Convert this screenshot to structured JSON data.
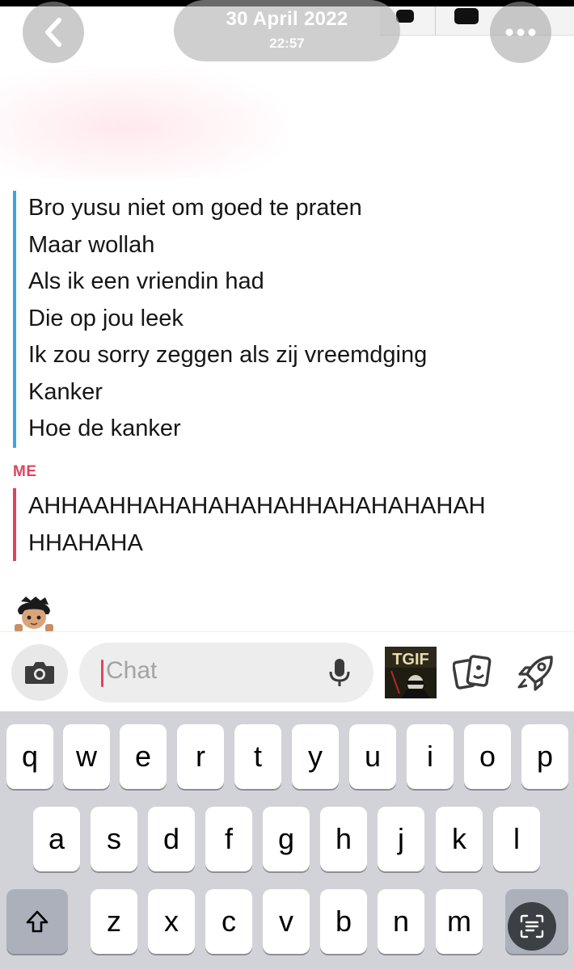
{
  "header": {
    "date": "30 April 2022",
    "time": "22:57"
  },
  "conversation": {
    "incoming_lines": [
      "Bro yusu niet om goed te praten",
      "Maar wollah",
      "Als ik een vriendin had",
      "Die op jou leek",
      "Ik zou sorry zeggen als zij vreemdging",
      "Kanker",
      "Hoe de kanker"
    ],
    "me_label": "ME",
    "outgoing_lines": [
      "AHHAAHHAHAHAHAHAHHAHAHAHAHAH",
      "HHAHAHA"
    ],
    "colors": {
      "incoming_bar": "#3aa7e0",
      "outgoing_bar": "#e0435c"
    }
  },
  "chat_bar": {
    "placeholder": "Chat",
    "sticker_label": "TGIF",
    "icons": [
      "camera-icon",
      "microphone-icon",
      "cards-icon",
      "rocket-icon"
    ]
  },
  "keyboard": {
    "row1": [
      "q",
      "w",
      "e",
      "r",
      "t",
      "y",
      "u",
      "i",
      "o",
      "p"
    ],
    "row2": [
      "a",
      "s",
      "d",
      "f",
      "g",
      "h",
      "j",
      "k",
      "l"
    ],
    "row3": [
      "z",
      "x",
      "c",
      "v",
      "b",
      "n",
      "m"
    ],
    "icons": [
      "shift-icon",
      "text-scan-icon"
    ]
  }
}
